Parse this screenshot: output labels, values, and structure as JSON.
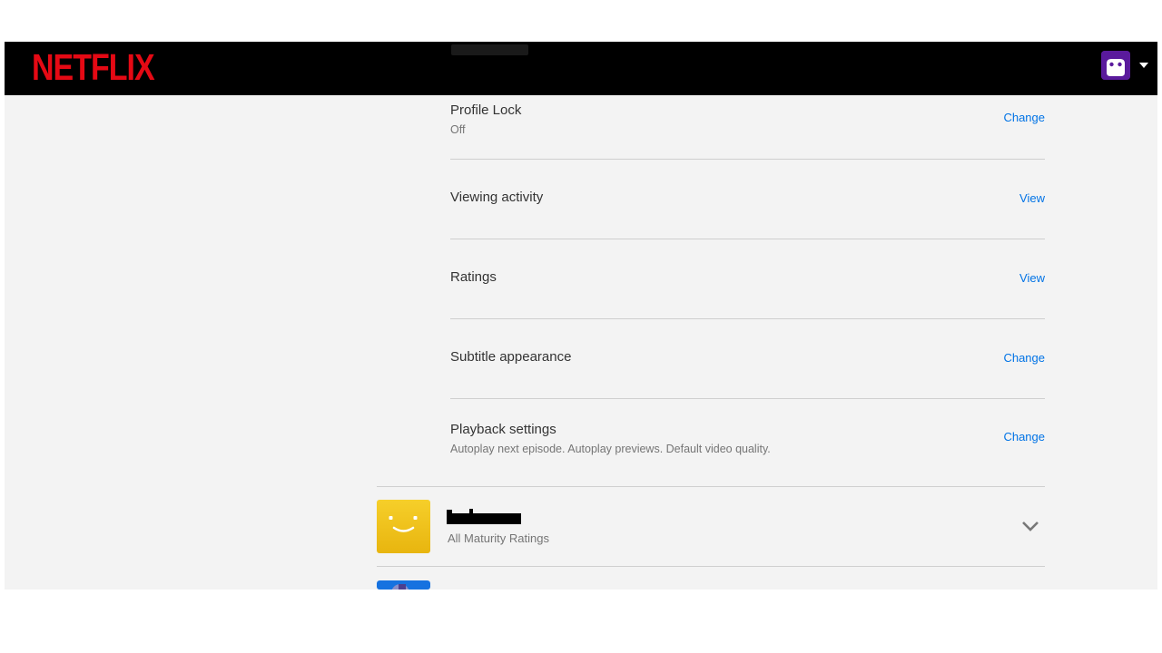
{
  "header": {
    "logo": "NETFLIX"
  },
  "settings": [
    {
      "title": "Profile Lock",
      "subtitle": "Off",
      "action": "Change"
    },
    {
      "title": "Viewing activity",
      "subtitle": "",
      "action": "View"
    },
    {
      "title": "Ratings",
      "subtitle": "",
      "action": "View"
    },
    {
      "title": "Subtitle appearance",
      "subtitle": "",
      "action": "Change"
    },
    {
      "title": "Playback settings",
      "subtitle": "Autoplay next episode. Autoplay previews. Default video quality.",
      "action": "Change"
    }
  ],
  "profiles": [
    {
      "subtitle": "All Maturity Ratings",
      "avatar_color": "#f2c21b",
      "icon": "smiley-avatar-icon"
    }
  ],
  "colors": {
    "brand": "#e50914",
    "link": "#0073e6",
    "background": "#f3f3f3"
  }
}
